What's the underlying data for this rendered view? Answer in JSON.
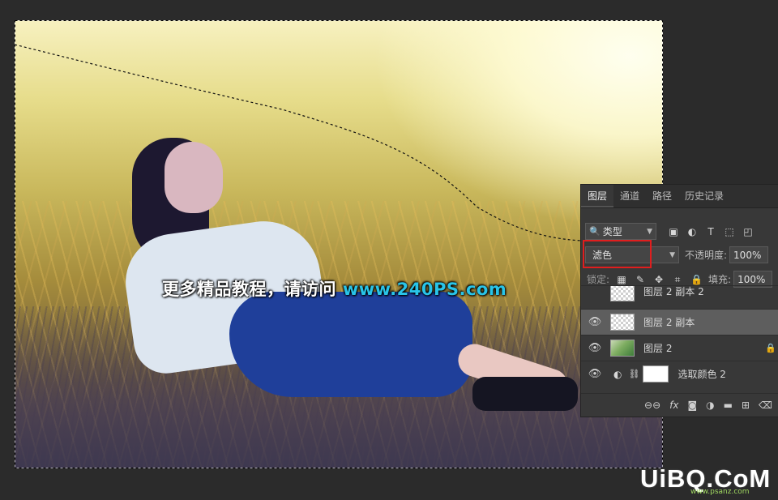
{
  "watermark": {
    "center_text": "更多精品教程，请访问",
    "center_url": "www.240PS.com",
    "corner_logo": "UiBQ.CoM",
    "corner_sub": "www.psanz.com"
  },
  "layers_panel": {
    "tabs": [
      {
        "label": "图层",
        "active": true
      },
      {
        "label": "通道",
        "active": false
      },
      {
        "label": "路径",
        "active": false
      },
      {
        "label": "历史记录",
        "active": false
      }
    ],
    "filter_type": "类型",
    "blend_mode": "滤色",
    "opacity_label": "不透明度:",
    "opacity_value": "100%",
    "lock_label": "锁定:",
    "fill_label": "填充:",
    "fill_value": "100%",
    "layers": [
      {
        "name": "图层 2 副本 2",
        "visible": false,
        "selected": false,
        "thumb": "transparent"
      },
      {
        "name": "图层 2 副本",
        "visible": true,
        "selected": true,
        "thumb": "transparent"
      },
      {
        "name": "图层 2",
        "visible": true,
        "selected": false,
        "thumb": "green"
      },
      {
        "name": "选取颜色 2",
        "visible": true,
        "selected": false,
        "thumb": "white"
      }
    ],
    "highlight_color": "#e01e1e"
  }
}
